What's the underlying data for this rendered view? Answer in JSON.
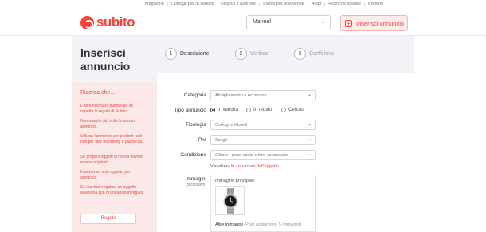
{
  "top_links": [
    "Magazine",
    "Consigli per la vendita",
    "Negozi e Aziende",
    "Subito per le Aziende",
    "Aiuto",
    "Ricerche salvate",
    "Preferiti"
  ],
  "header": {
    "logo_text": "subito",
    "user_name": "Manuel",
    "post_button_label": "Inserisci annuncio"
  },
  "page_title": "Inserisci annuncio",
  "steps": [
    {
      "num": "1",
      "label": "Descrizione",
      "active": true
    },
    {
      "num": "2",
      "label": "Verifica",
      "active": false
    },
    {
      "num": "3",
      "label": "Conferma",
      "active": false
    }
  ],
  "tips": {
    "title": "Ricorda che...",
    "items": [
      "L'annuncio sarà pubblicato se rispetta le regole di Subito.",
      "Non inserire più volte lo stesso annuncio.",
      "Utilizza l'annuncio per prodotti reali non per fare marketing o pubblicità.",
      "Se proponi oggetti di marca devono essere originali.",
      "Inserisci un solo oggetto per annuncio.",
      "Se inserisci regalare un oggetto seleziona tipo di annuncio in regalo."
    ],
    "rules_button": "Regole"
  },
  "form": {
    "categoria_label": "Categoria",
    "categoria_value": "Abbigliamento e Accessori",
    "tipo_label": "Tipo annuncio",
    "tipo_options": [
      "In vendita",
      "In regalo",
      "Cercasi"
    ],
    "tipologia_label": "Tipologia",
    "tipologia_value": "Orologi e Gioielli",
    "per_label": "Per",
    "per_value": "Scegli",
    "condizione_label": "Condizione",
    "condizione_value": "Ottimo - poco usato e ben conservato",
    "cond_link_prefix": "Visualizza le ",
    "cond_link_text": "condizioni dell'oggetto",
    "immagini_label": "Immagini",
    "immagini_sub": "(facoltativo)",
    "main_image_label": "Immagine principale",
    "more_images_label": "Altre immagini",
    "more_images_hint": "(Puoi aggiungere 5 immagini)"
  },
  "colors": {
    "brand": "#f9423a",
    "panel": "#f2f3f7",
    "tips_bg": "#fbe9e8"
  }
}
